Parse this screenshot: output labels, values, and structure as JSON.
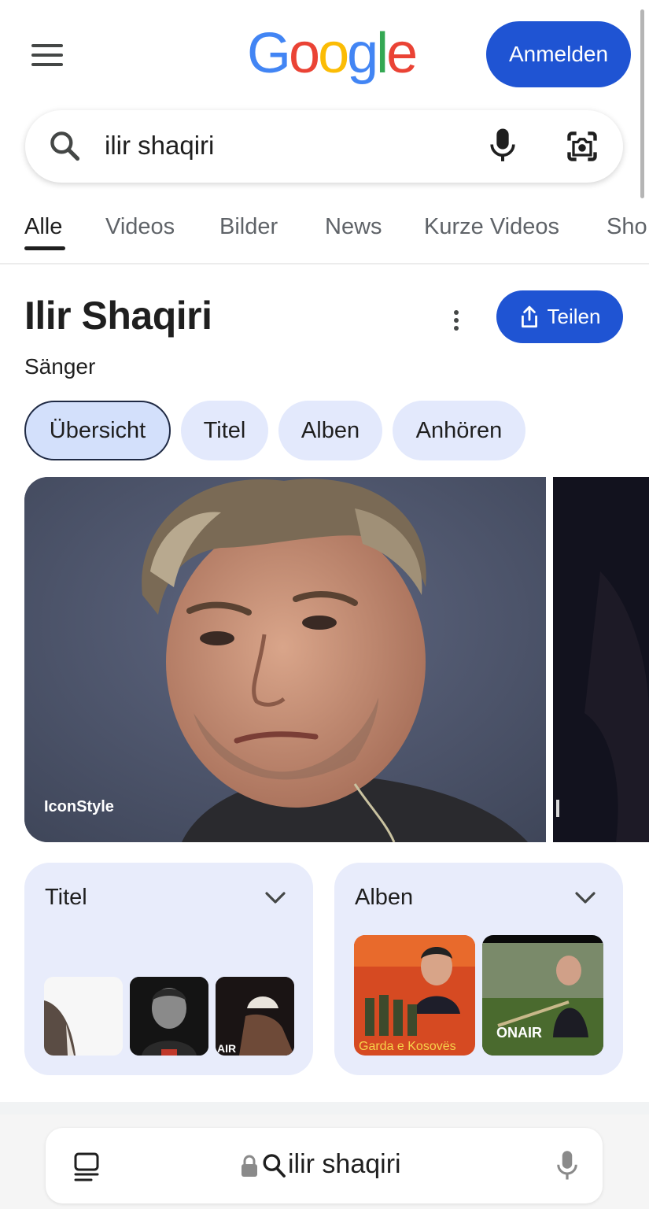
{
  "header": {
    "logo_letters": [
      "G",
      "o",
      "o",
      "g",
      "l",
      "e"
    ],
    "signin_label": "Anmelden"
  },
  "search": {
    "query": "ilir shaqiri"
  },
  "tabs": [
    {
      "label": "Alle",
      "active": true
    },
    {
      "label": "Videos"
    },
    {
      "label": "Bilder"
    },
    {
      "label": "News"
    },
    {
      "label": "Kurze Videos"
    },
    {
      "label": "Sho"
    }
  ],
  "knowledge_panel": {
    "title": "Ilir Shaqiri",
    "subtitle": "Sänger",
    "share_label": "Teilen",
    "chips": [
      {
        "label": "Übersicht",
        "active": true
      },
      {
        "label": "Titel"
      },
      {
        "label": "Alben"
      },
      {
        "label": "Anhören"
      }
    ],
    "image_credit": "IconStyle"
  },
  "cards": {
    "titel": {
      "label": "Titel",
      "thumb_texts": [
        "AIR"
      ]
    },
    "alben": {
      "label": "Alben",
      "album_texts": [
        "Garda e Kosovës",
        "ONAIR"
      ]
    }
  },
  "bottom_bar": {
    "url_text": "ilir shaqiri"
  },
  "colors": {
    "accent": "#1f54d3",
    "chip_bg": "#e3e9fc",
    "card_bg": "#e8ecfb"
  }
}
